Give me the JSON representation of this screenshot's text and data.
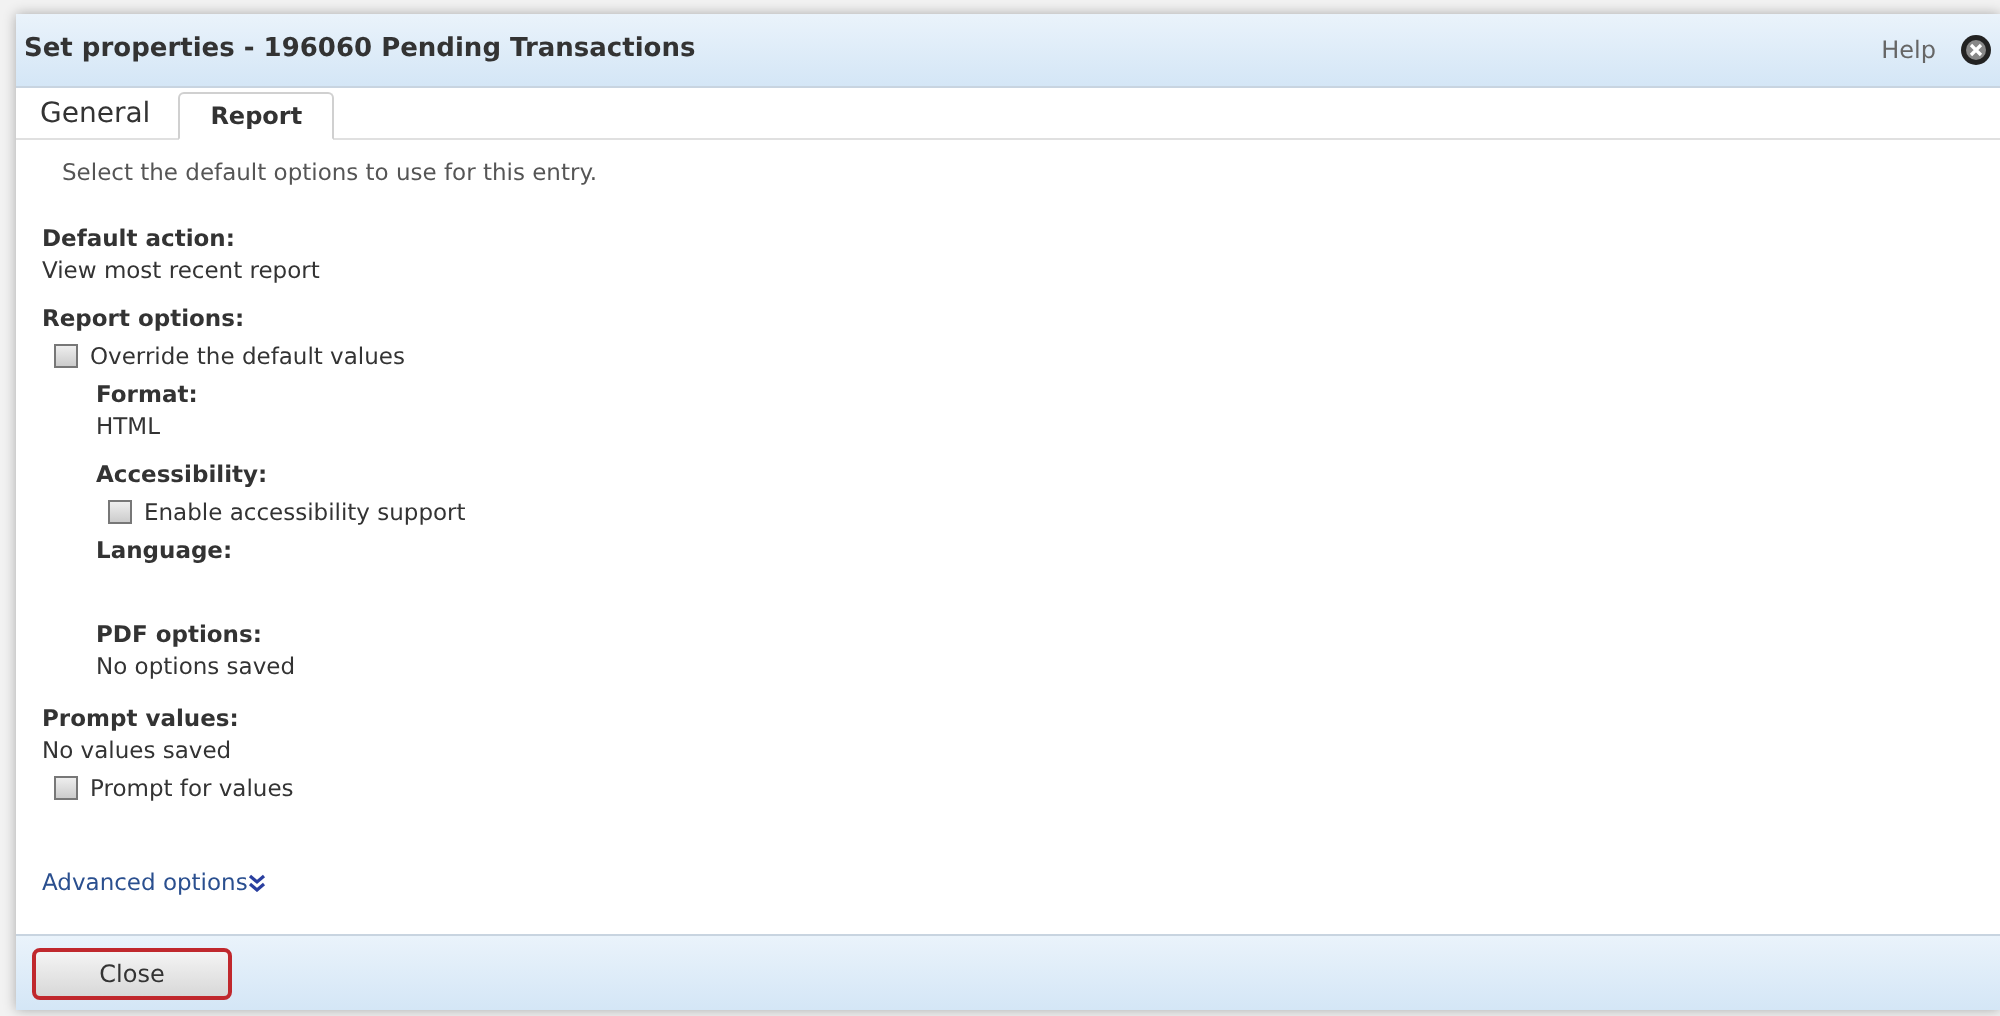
{
  "window": {
    "title": "Set properties - 196060 Pending Transactions",
    "help": "Help"
  },
  "tabs": [
    {
      "label": "General",
      "selected": false
    },
    {
      "label": "Report",
      "selected": true
    }
  ],
  "instruction": "Select the default options to use for this entry.",
  "default_action": {
    "label": "Default action:",
    "value": "View most recent report"
  },
  "report_options": {
    "label": "Report options:",
    "override": {
      "label": "Override the default values",
      "checked": false
    },
    "format": {
      "label": "Format:",
      "value": "HTML"
    },
    "accessibility": {
      "label": "Accessibility:",
      "checkbox": {
        "label": "Enable accessibility support",
        "checked": false
      }
    },
    "language": {
      "label": "Language:"
    },
    "pdf_options": {
      "label": "PDF options:",
      "value": "No options saved"
    }
  },
  "prompt_values": {
    "label": "Prompt values:",
    "value": "No values saved",
    "checkbox": {
      "label": "Prompt for values",
      "checked": false
    }
  },
  "advanced_options": {
    "label": "Advanced options",
    "expanded": false
  },
  "footer": {
    "buttons": [
      {
        "label": "Close",
        "focused": true
      }
    ]
  }
}
